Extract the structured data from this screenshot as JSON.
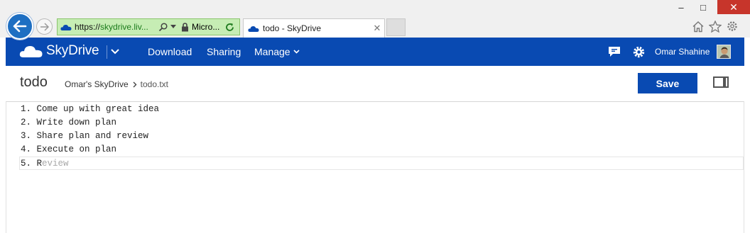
{
  "browser": {
    "window_controls": {
      "minimize": "–",
      "maximize": "□",
      "close": "✕"
    },
    "address_url_scheme": "https://",
    "address_url_domain": "skydrive.liv...",
    "address_cert": "Micro...",
    "tab_title": "todo - SkyDrive",
    "tab_close": "✕",
    "address_bar_color": "#c6edb4"
  },
  "appbar": {
    "brand": "SkyDrive",
    "nav": {
      "download": "Download",
      "sharing": "Sharing",
      "manage": "Manage"
    },
    "user_name": "Omar Shahine",
    "color": "#094ab2"
  },
  "file": {
    "title": "todo",
    "breadcrumb_root": "Omar's SkyDrive",
    "breadcrumb_current": "todo.txt",
    "save_label": "Save"
  },
  "editor": {
    "lines": [
      "1. Come up with great idea",
      "2. Write down plan",
      "3. Share plan and review",
      "4. Execute on plan"
    ],
    "active_line_typed": "5. R",
    "active_line_suggestion": "eview"
  }
}
